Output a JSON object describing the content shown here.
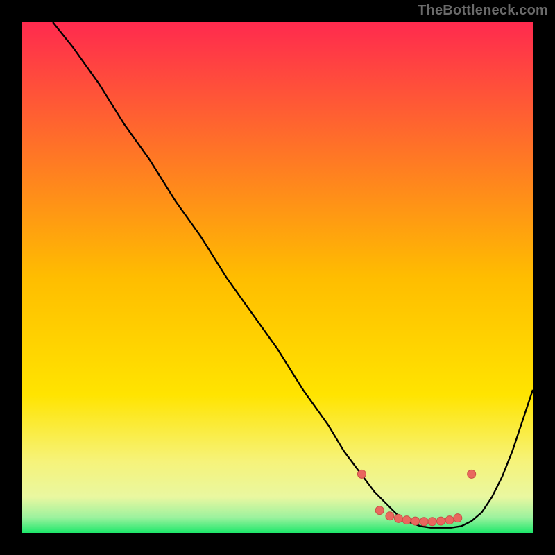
{
  "watermark": "TheBottleneck.com",
  "colors": {
    "gradient_top": "#ff2a4e",
    "gradient_mid": "#ffd400",
    "gradient_khaki": "#f2f090",
    "gradient_green": "#1ee86b",
    "curve_stroke": "#000000",
    "dot_fill": "#e9675e",
    "dot_stroke": "#c94f46"
  },
  "chart_data": {
    "type": "line",
    "title": "",
    "xlabel": "",
    "ylabel": "",
    "xlim": [
      0,
      100
    ],
    "ylim": [
      0,
      100
    ],
    "legend": false,
    "grid": false,
    "annotations": [
      "TheBottleneck.com"
    ],
    "series": [
      {
        "name": "bottleneck-curve",
        "x": [
          6,
          10,
          15,
          20,
          25,
          30,
          35,
          40,
          45,
          50,
          55,
          60,
          63,
          66,
          69,
          72,
          74,
          76,
          78,
          80,
          82,
          84,
          86,
          88,
          90,
          92,
          94,
          96,
          98,
          100
        ],
        "y": [
          100,
          95,
          88,
          80,
          73,
          65,
          58,
          50,
          43,
          36,
          28,
          21,
          16,
          12,
          8,
          5,
          3,
          2,
          1.3,
          1,
          1,
          1,
          1.3,
          2.3,
          4,
          7,
          11,
          16,
          22,
          28
        ]
      }
    ],
    "highlight_points": {
      "name": "optimal-zone-dots",
      "x": [
        66.5,
        70,
        72,
        73.7,
        75.3,
        77,
        78.7,
        80.3,
        82,
        83.7,
        85.3,
        88
      ],
      "y": [
        11.5,
        4.4,
        3.3,
        2.8,
        2.5,
        2.3,
        2.2,
        2.2,
        2.3,
        2.5,
        2.9,
        11.5
      ]
    }
  }
}
